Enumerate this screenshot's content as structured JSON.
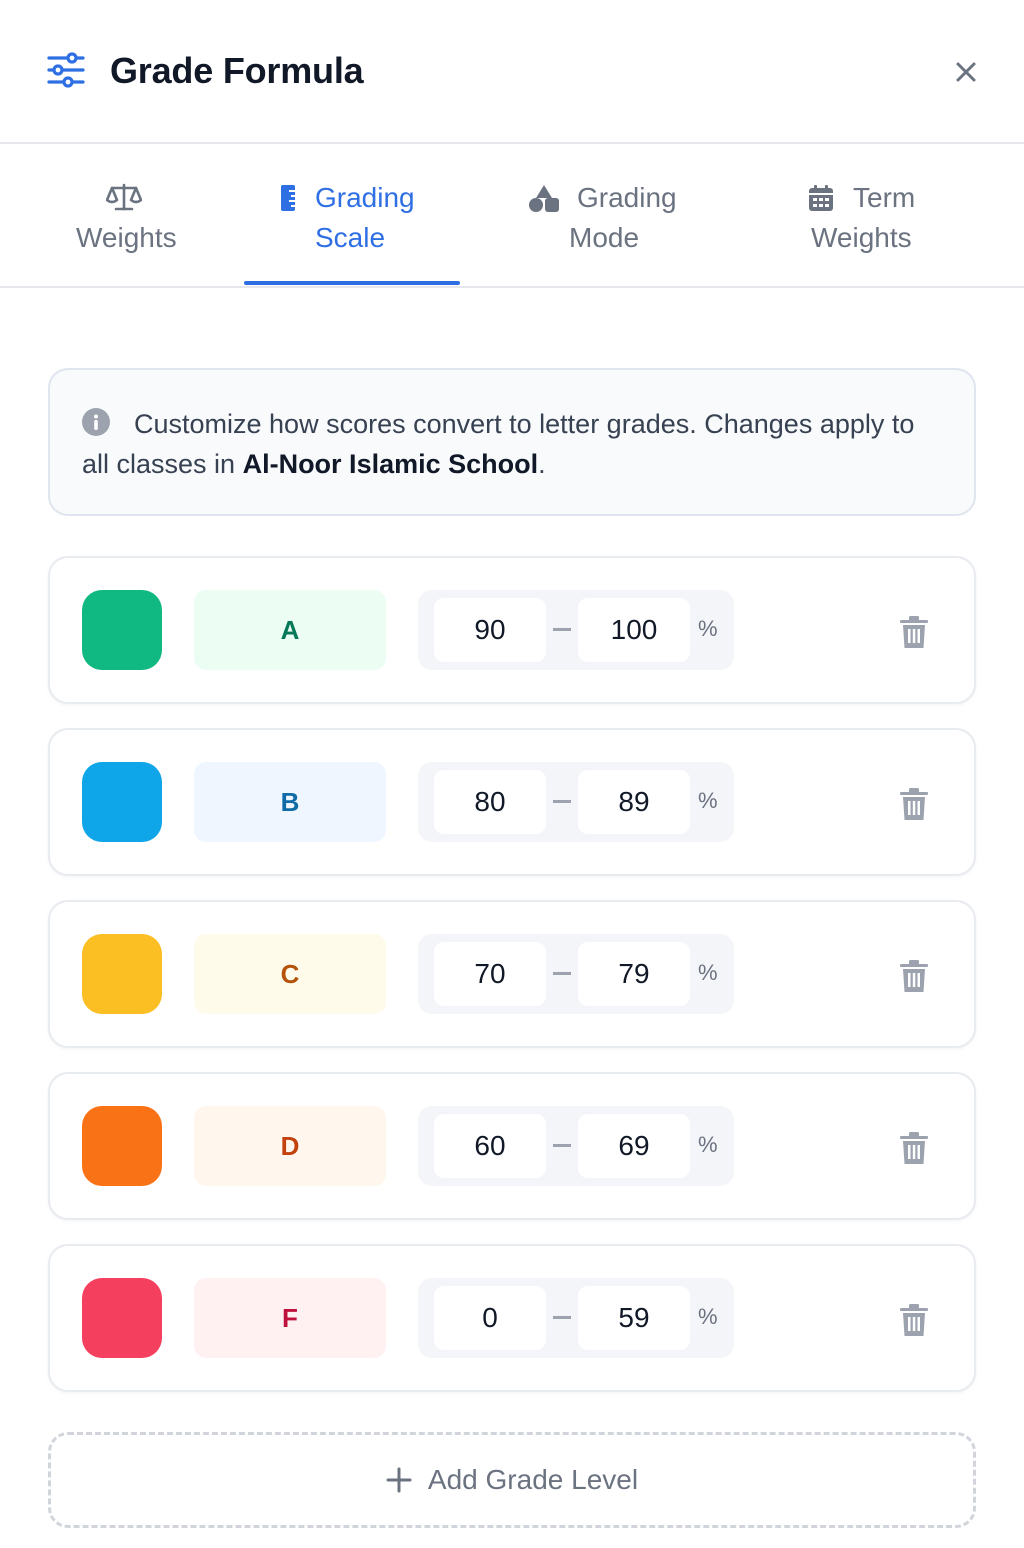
{
  "header": {
    "title": "Grade Formula",
    "icon": "sliders-icon",
    "close_icon": "close-icon"
  },
  "tabs": [
    {
      "line1": "Weights",
      "line2": "",
      "icon": "scale-icon",
      "active": false
    },
    {
      "line1": "Grading",
      "line2": "Scale",
      "icon": "ruler-icon",
      "active": true
    },
    {
      "line1": "Grading",
      "line2": "Mode",
      "icon": "shapes-icon",
      "active": false
    },
    {
      "line1": "Term",
      "line2": "Weights",
      "icon": "calendar-icon",
      "active": false
    }
  ],
  "info": {
    "text_before": "Customize how scores convert to letter grades. Changes apply to all classes in ",
    "school": "Al-Noor Islamic School",
    "text_after": "."
  },
  "grades": [
    {
      "letter": "A",
      "min": "90",
      "max": "100",
      "unit": "%",
      "color": "#10b981",
      "bg": "#ecfdf3",
      "text_color": "#047857"
    },
    {
      "letter": "B",
      "min": "80",
      "max": "89",
      "unit": "%",
      "color": "#0ea5e9",
      "bg": "#eff6ff",
      "text_color": "#0e6ba8"
    },
    {
      "letter": "C",
      "min": "70",
      "max": "79",
      "unit": "%",
      "color": "#fbbf24",
      "bg": "#fffbeb",
      "text_color": "#b45309"
    },
    {
      "letter": "D",
      "min": "60",
      "max": "69",
      "unit": "%",
      "color": "#f97316",
      "bg": "#fff7ed",
      "text_color": "#c2410c"
    },
    {
      "letter": "F",
      "min": "0",
      "max": "59",
      "unit": "%",
      "color": "#f43f5e",
      "bg": "#fff1f2",
      "text_color": "#be123c"
    }
  ],
  "add_button": {
    "label": "Add Grade Level",
    "icon": "plus-icon"
  },
  "colors": {
    "accent": "#2f6fe4",
    "muted": "#6b7280",
    "border": "#e5e7eb"
  }
}
